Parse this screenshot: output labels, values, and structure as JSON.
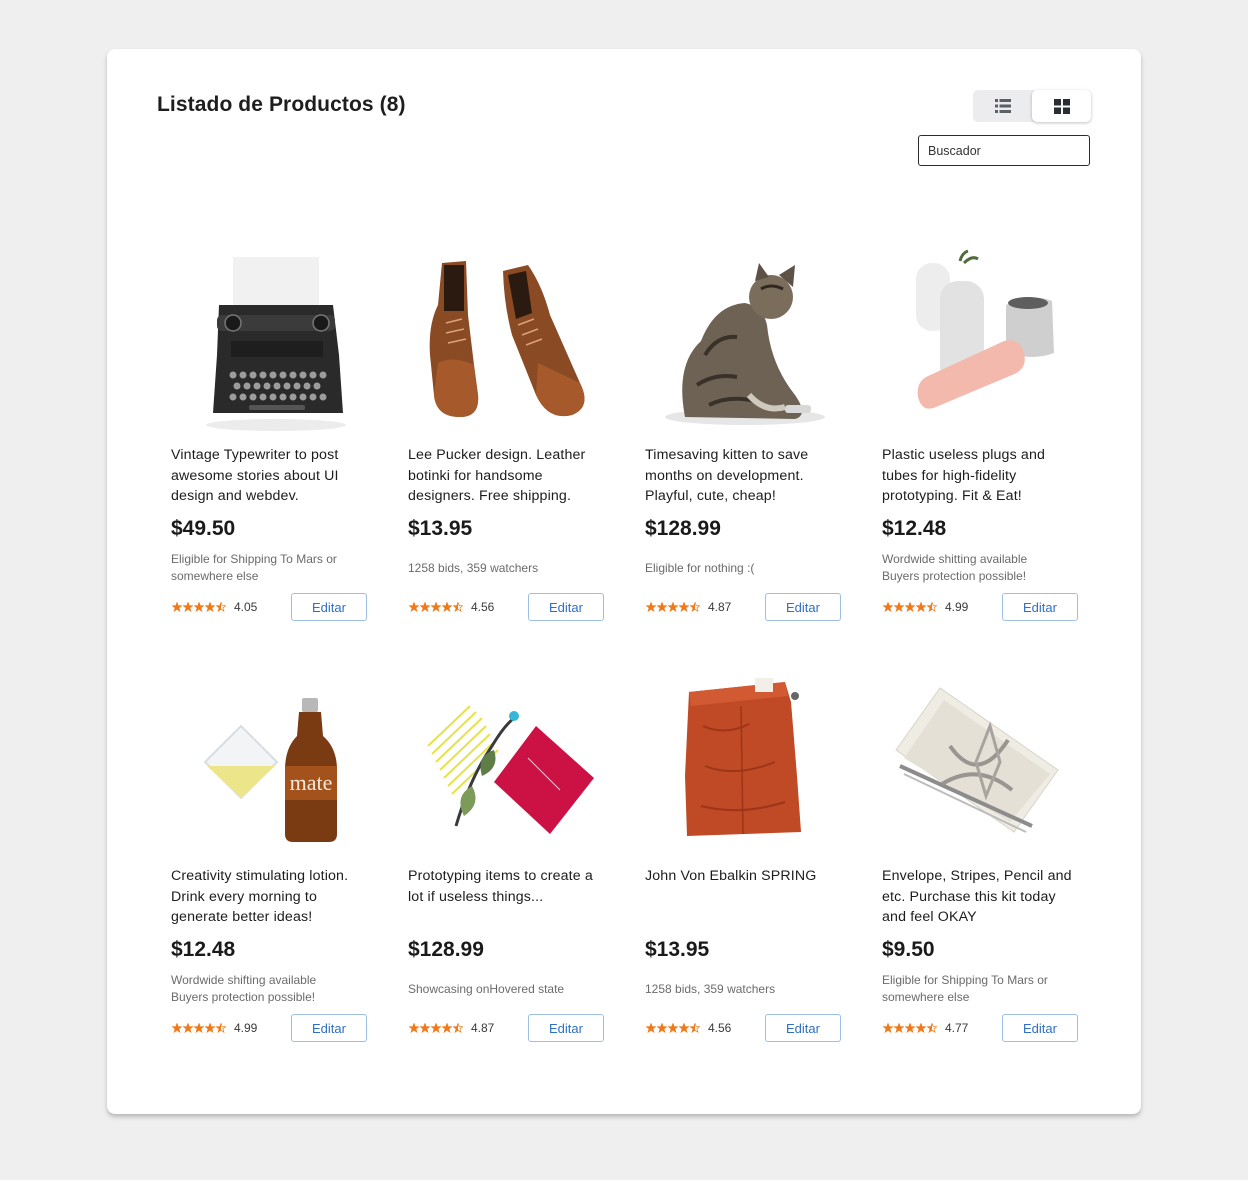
{
  "header": {
    "title": "Listado de Productos (8)",
    "search_placeholder": "Buscador",
    "view_modes": [
      {
        "icon": "list-view-icon",
        "active": false
      },
      {
        "icon": "grid-view-icon",
        "active": true
      }
    ]
  },
  "colors": {
    "star": "#f07a1a",
    "button_text": "#2f6fc6",
    "button_border": "#9dbfe6"
  },
  "products": [
    {
      "image": "typewriter-image",
      "description": "Vintage Typewriter to post awesome stories about UI design and webdev.",
      "price": "$49.50",
      "meta": "Eligible for Shipping To Mars or somewhere else",
      "rating": "4.05",
      "stars": 4.5,
      "button": "Editar"
    },
    {
      "image": "leather-boots-image",
      "description": "Lee Pucker design. Leather botinki for handsome designers. Free shipping.",
      "price": "$13.95",
      "meta": "1258 bids, 359 watchers",
      "rating": "4.56",
      "stars": 4.5,
      "button": "Editar"
    },
    {
      "image": "kitten-image",
      "description": "Timesaving kitten to save months on development. Playful, cute, cheap!",
      "price": "$128.99",
      "meta": "Eligible for nothing :(",
      "rating": "4.87",
      "stars": 4.5,
      "button": "Editar"
    },
    {
      "image": "plastic-plugs-image",
      "description": "Plastic useless plugs and tubes for high-fidelity prototyping. Fit & Eat!",
      "price": "$12.48",
      "meta": "Wordwide shitting available\nBuyers protection possible!",
      "rating": "4.99",
      "stars": 4.5,
      "button": "Editar"
    },
    {
      "image": "mate-bottle-image",
      "description": "Creativity stimulating lotion. Drink every morning to generate better ideas!",
      "price": "$12.48",
      "meta": "Wordwide shifting available\nBuyers protection possible!",
      "rating": "4.99",
      "stars": 4.5,
      "button": "Editar"
    },
    {
      "image": "red-notebook-image",
      "description": "Prototyping items to create a lot if useless things...",
      "price": "$128.99",
      "meta": "Showcasing onHovered state",
      "rating": "4.87",
      "stars": 4.5,
      "button": "Editar"
    },
    {
      "image": "red-pants-image",
      "description": "John Von Ebalkin SPRING",
      "price": "$13.95",
      "meta": "1258 bids, 359 watchers",
      "rating": "4.56",
      "stars": 4.5,
      "button": "Editar"
    },
    {
      "image": "envelope-kit-image",
      "description": "Envelope, Stripes, Pencil and etc. Purchase this kit today and feel OKAY",
      "price": "$9.50",
      "meta": "Eligible for Shipping To Mars or somewhere else",
      "rating": "4.77",
      "stars": 4.5,
      "button": "Editar"
    }
  ]
}
